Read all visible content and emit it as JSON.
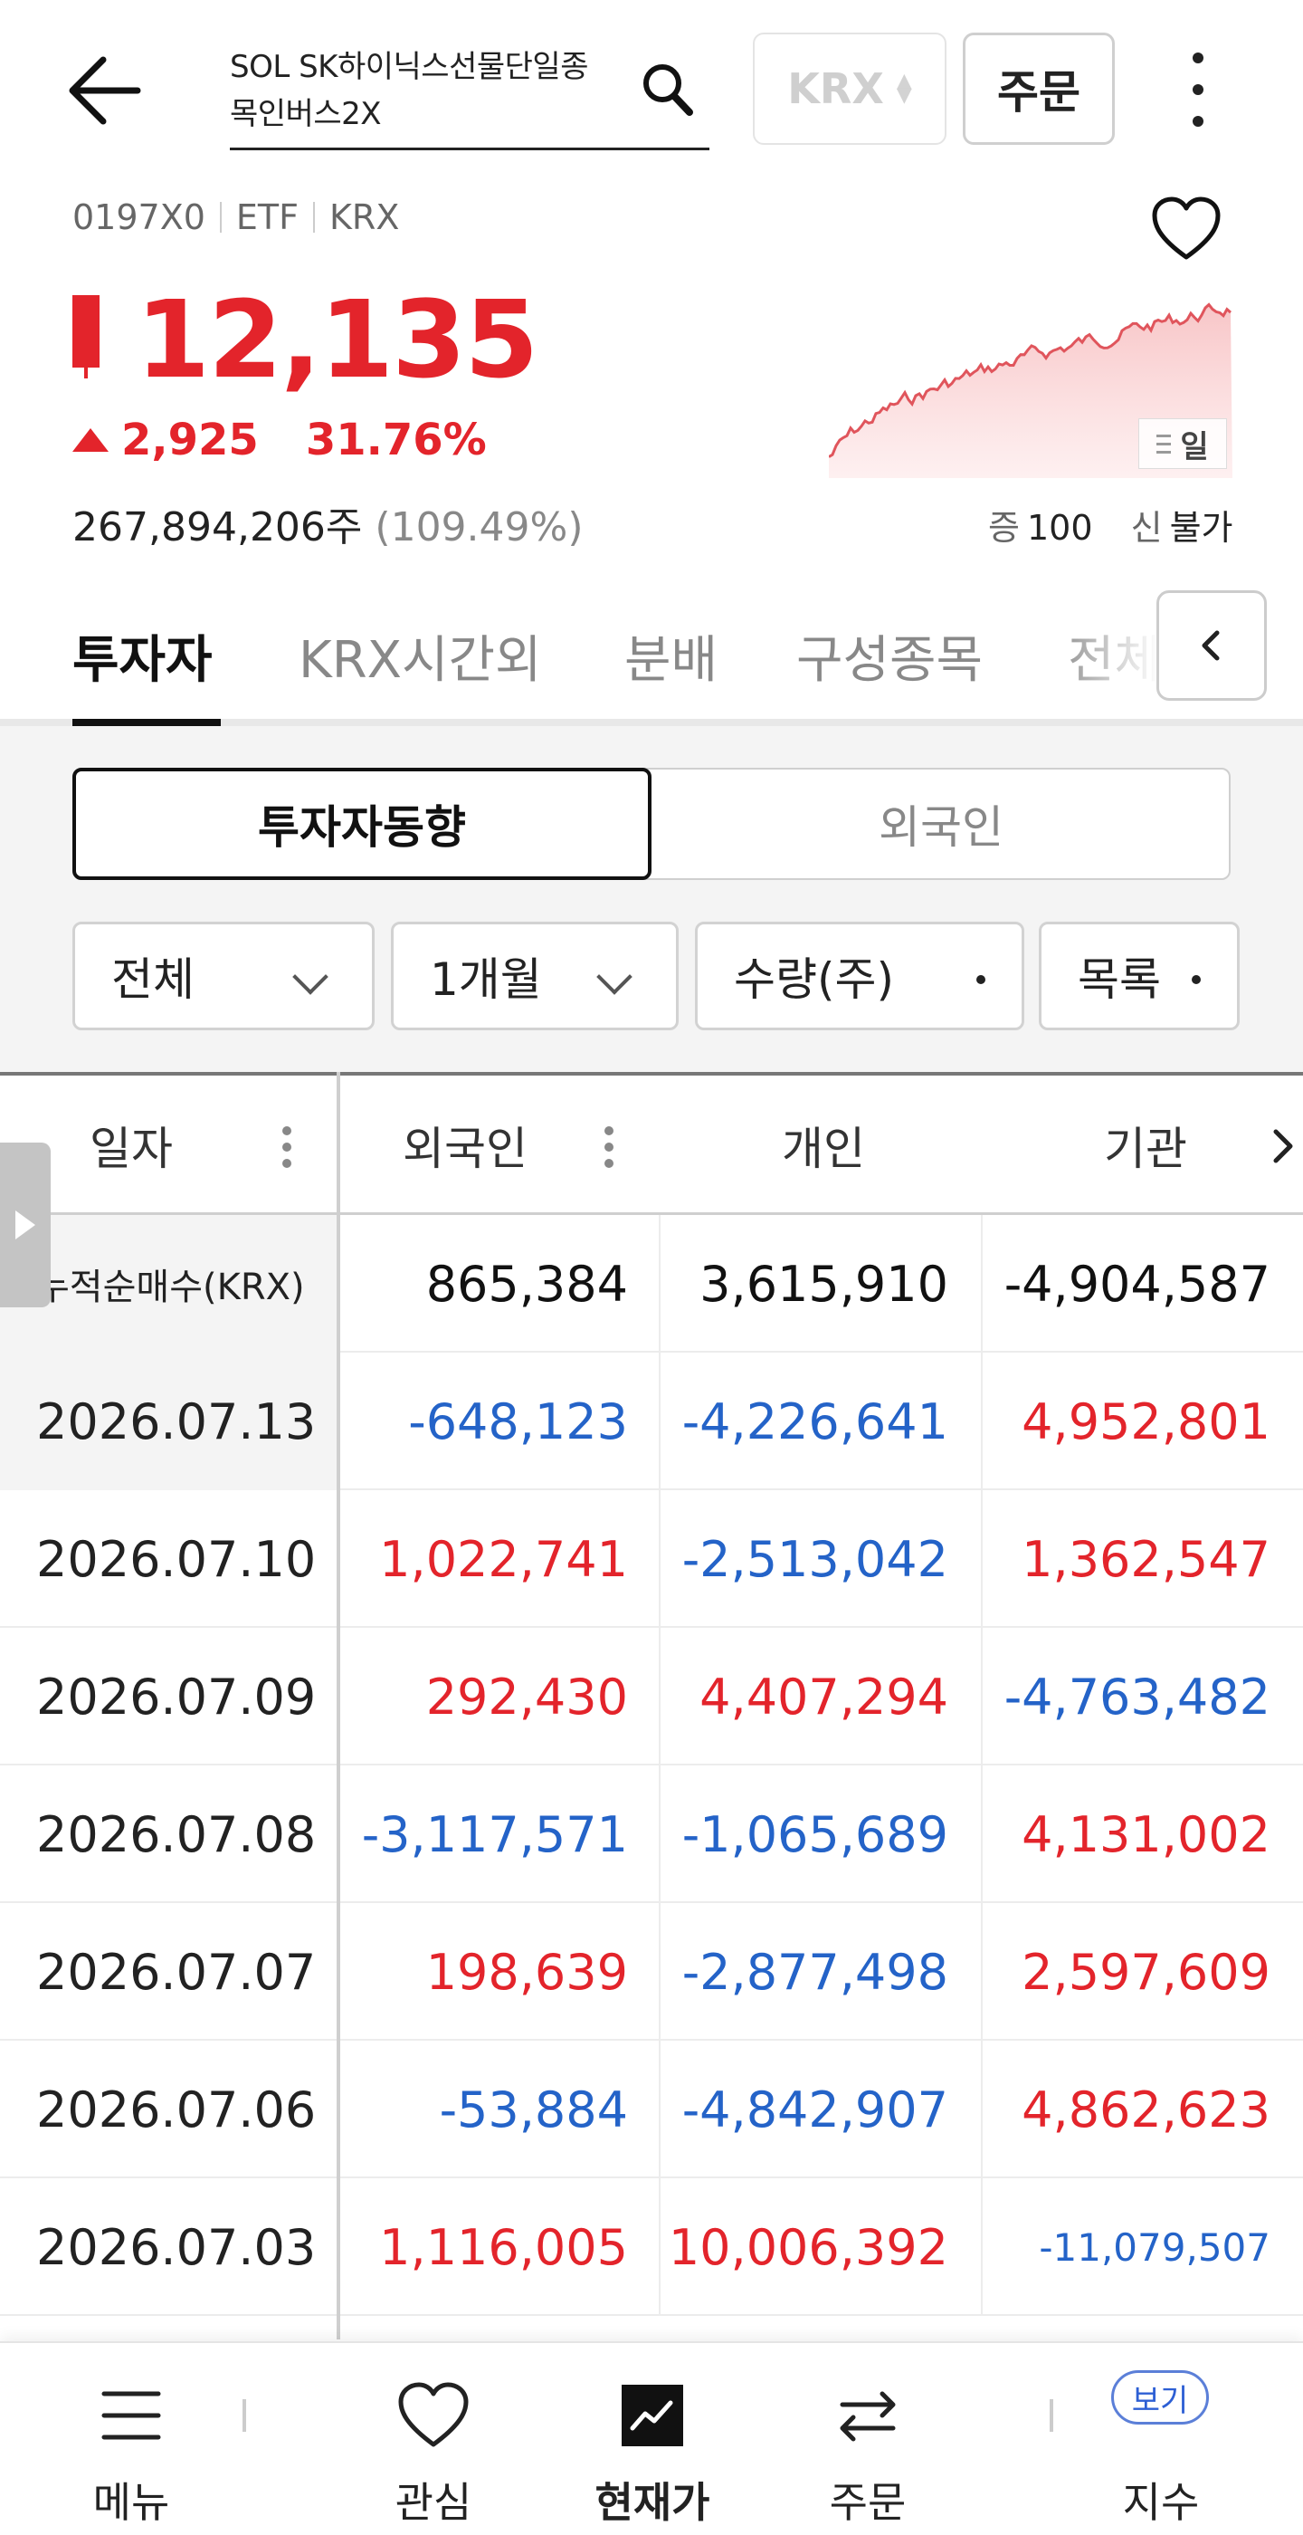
{
  "header": {
    "search_value": "SOL SK하이닉스선물단일종\n목인버스2X",
    "market": "KRX",
    "order_label": "주문"
  },
  "stock": {
    "code": "0197X0",
    "type": "ETF",
    "market": "KRX",
    "price": "12,135",
    "change": "2,925",
    "change_rate": "31.76%",
    "volume": "267,894,206주",
    "volume_pct": "(109.49%)",
    "margin_label": "증",
    "margin_value": "100",
    "credit_label": "신",
    "credit_value": "불가",
    "period": "일",
    "up_color": "#e3242b",
    "down_color": "#2463c8"
  },
  "tabs": [
    "투자자",
    "KRX시간외",
    "분배",
    "구성종목",
    "전체"
  ],
  "segments": {
    "active": "투자자동향",
    "inactive": "외국인"
  },
  "filters": {
    "scope": "전체",
    "period": "1개월",
    "unit": "수량(주)",
    "view": "목록"
  },
  "table": {
    "headers": [
      "일자",
      "외국인",
      "개인",
      "기관"
    ],
    "rows": [
      {
        "date": "누적순매수(KRX)",
        "foreign": "865,384",
        "individual": "3,615,910",
        "institution": "-4,904,587"
      },
      {
        "date": "2026.07.13",
        "foreign": "-648,123",
        "individual": "-4,226,641",
        "institution": "4,952,801"
      },
      {
        "date": "2026.07.10",
        "foreign": "1,022,741",
        "individual": "-2,513,042",
        "institution": "1,362,547"
      },
      {
        "date": "2026.07.09",
        "foreign": "292,430",
        "individual": "4,407,294",
        "institution": "-4,763,482"
      },
      {
        "date": "2026.07.08",
        "foreign": "-3,117,571",
        "individual": "-1,065,689",
        "institution": "4,131,002"
      },
      {
        "date": "2026.07.07",
        "foreign": "198,639",
        "individual": "-2,877,498",
        "institution": "2,597,609"
      },
      {
        "date": "2026.07.06",
        "foreign": "-53,884",
        "individual": "-4,842,907",
        "institution": "4,862,623"
      },
      {
        "date": "2026.07.03",
        "foreign": "1,116,005",
        "individual": "10,006,392",
        "institution": "-11,079,507"
      }
    ]
  },
  "bottom_nav": {
    "items": [
      "메뉴",
      "관심",
      "현재가",
      "주문",
      "지수"
    ],
    "badge": "보기"
  }
}
